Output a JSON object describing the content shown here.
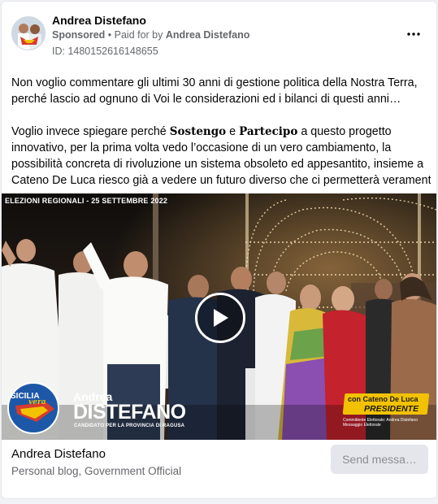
{
  "post": {
    "page_name": "Andrea Distefano",
    "sponsored_label": "Sponsored",
    "separator": " • ",
    "paid_for_prefix": "Paid for by ",
    "paid_for_name": "Andrea Distefano",
    "ad_id": "ID: 1480152616148655",
    "more_icon": "more-horizontal-icon",
    "body": {
      "line1": "Non voglio commentare gli ultimi 30 anni di gestione politica della Nostra Terra,",
      "line2": "perché lascio ad ognuno di Voi le considerazioni ed i bilanci di questi anni…",
      "line3_pre": "Voglio invece spiegare perché ",
      "line3_b1": "Sostengo",
      "line3_mid": " e ",
      "line3_b2": "Partecipo",
      "line3_post": " a questo progetto",
      "line4": "innovativo, per la prima volta vedo l’occasione di un vero cambiamento, la",
      "line5": "possibilità concreta di rivoluzione un sistema obsoleto ed appesantito, insieme a",
      "line6": "Cateno De Luca riesco già a vedere un futuro diverso che ci permetterà veramente…"
    }
  },
  "media": {
    "caption": "ELEZIONI REGIONALI - 25 SETTEMBRE 2022",
    "play_icon": "play-icon",
    "logo_text_top": "SICILIA",
    "logo_text_script": "vera",
    "candidate_first": "Andrea",
    "candidate_last": "DISTEFANO",
    "candidate_role": "CANDIDATO PER LA PROVINCIA DI RAGUSA",
    "banner_line1": "con Cateno De Luca",
    "banner_line2": "PRESIDENTE",
    "committee": "Committente Elettorale: Andrea Distefano Messaggio Elettorale"
  },
  "footer": {
    "title": "Andrea Distefano",
    "subtitle": "Personal blog, Government Official",
    "send_button": "Send messa…"
  },
  "colors": {
    "muted": "#65676b",
    "button_bg": "#e4e6eb",
    "banner": "#f2c200"
  }
}
